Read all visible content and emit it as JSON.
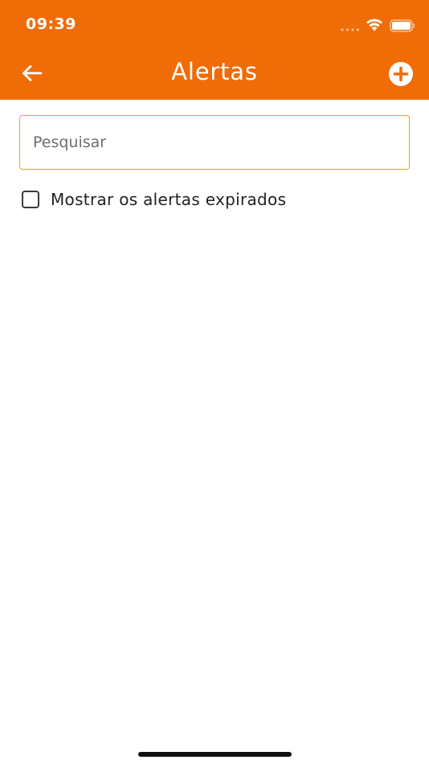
{
  "status_bar": {
    "time": "09:39"
  },
  "header": {
    "title": "Alertas",
    "back_icon": "arrow-left-icon",
    "add_icon": "plus-circle-icon"
  },
  "search": {
    "value": "",
    "placeholder": "Pesquisar"
  },
  "filters": {
    "show_expired_label": "Mostrar os alertas expirados",
    "show_expired_checked": false
  },
  "colors": {
    "header_bg": "#F06C07",
    "search_border": "#F0A020",
    "text": "#222222"
  }
}
